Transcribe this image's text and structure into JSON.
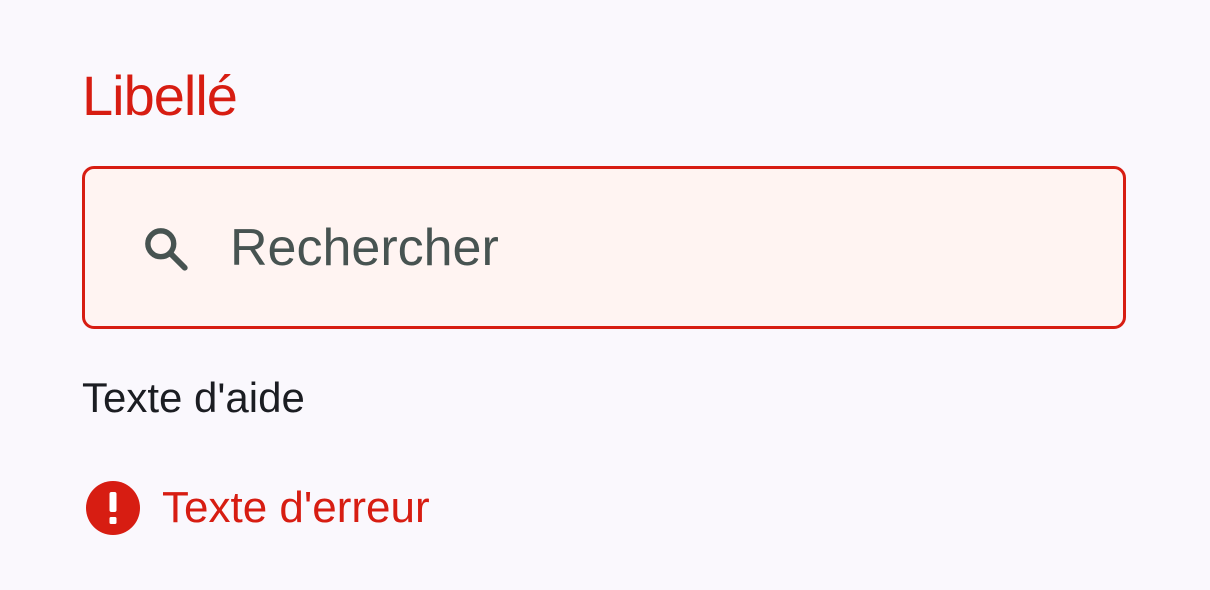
{
  "field": {
    "label": "Libellé",
    "search": {
      "placeholder": "Rechercher",
      "value": "",
      "icon": "search-icon"
    },
    "helper_text": "Texte d'aide",
    "error": {
      "icon": "error-exclamation-icon",
      "text": "Texte d'erreur"
    }
  },
  "colors": {
    "error": "#d71d12",
    "background": "#faf8fd",
    "input_background": "#fff4f2",
    "input_text": "#475351",
    "helper_text": "#1b1d22"
  }
}
